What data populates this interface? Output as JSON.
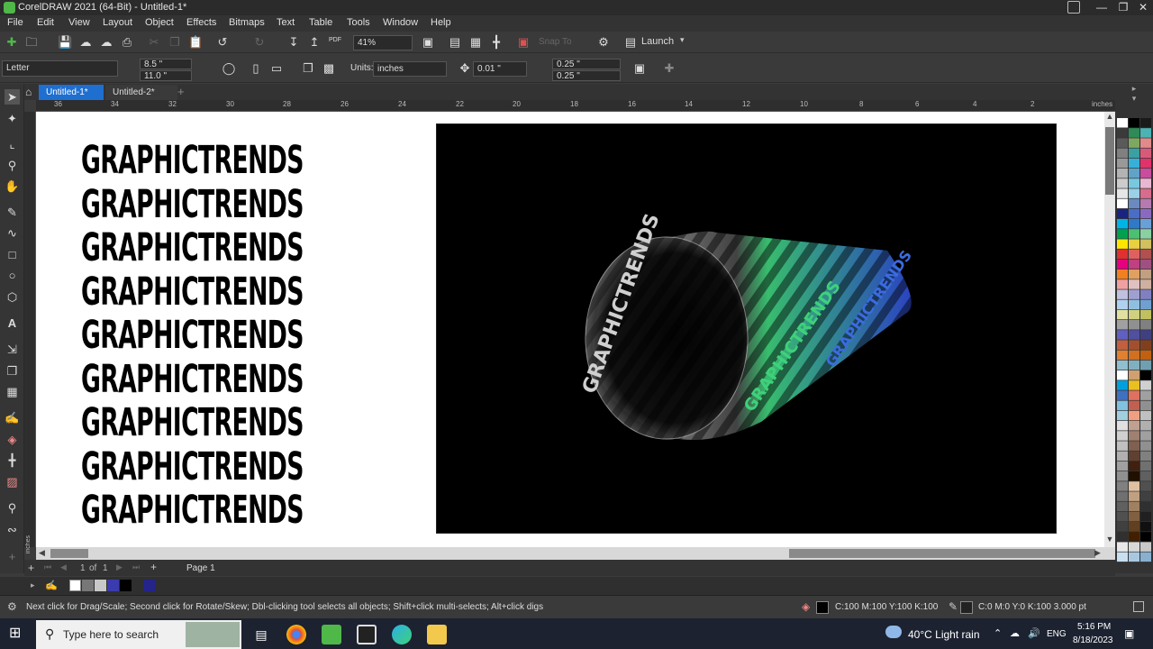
{
  "window": {
    "title": "CorelDRAW 2021 (64-Bit) - Untitled-1*",
    "controls": [
      "—",
      "❐",
      "✕"
    ]
  },
  "menu": [
    "File",
    "Edit",
    "View",
    "Layout",
    "Object",
    "Effects",
    "Bitmaps",
    "Text",
    "Table",
    "Tools",
    "Window",
    "Help"
  ],
  "toolbar": {
    "zoom": "41%",
    "snap_to": "Snap To",
    "launch": "Launch",
    "pdf_label": "PDF"
  },
  "propbar": {
    "page_size": "Letter",
    "width": "8.5 \"",
    "height": "11.0 \"",
    "units_label": "Units:",
    "units": "inches",
    "nudge": "0.01 \"",
    "dup_x": "0.25 \"",
    "dup_y": "0.25 \""
  },
  "tabs": [
    {
      "label": "Untitled-1*",
      "active": true
    },
    {
      "label": "Untitled-2*",
      "active": false
    }
  ],
  "ruler": {
    "unit_label": "inches",
    "h_ticks": [
      "36",
      "34",
      "32",
      "30",
      "28",
      "26",
      "24",
      "22",
      "20",
      "18",
      "16",
      "14",
      "12",
      "10",
      "8",
      "6",
      "4",
      "2"
    ],
    "v_unit": "inches"
  },
  "canvas": {
    "repeat_word": "GRAPHICTRENDS",
    "lines": [
      "GRAPHICTRENDS",
      "GRAPHICTRENDS",
      "GRAPHICTRENDS",
      "GRAPHICTRENDS",
      "GRAPHICTRENDS",
      "GRAPHICTRENDS",
      "GRAPHICTRENDS",
      "GRAPHICTRENDS",
      "GRAPHICTRENDS"
    ],
    "tube_text": "GRAPHICTRENDS GRAPHICTRENDS GRAPHICTRENDS"
  },
  "pagenav": {
    "page_indicator": "1",
    "of_label": "of",
    "total": "1",
    "page_tab": "Page 1"
  },
  "status": {
    "hint": "Next click for Drag/Scale; Second click for Rotate/Skew; Dbl-clicking tool selects all objects; Shift+click multi-selects; Alt+click digs",
    "fill": "C:100 M:100 Y:100 K:100",
    "outline": "C:0 M:0 Y:0 K:100  3.000 pt"
  },
  "taskbar": {
    "search_placeholder": "Type here to search",
    "weather": "40°C  Light rain",
    "lang": "ENG",
    "time": "5:16 PM",
    "date": "8/18/2023"
  },
  "colors": {
    "accent_tab": "#1e6fd0",
    "tube_green": "#3ed17a",
    "tube_blue": "#2f4bd6"
  }
}
